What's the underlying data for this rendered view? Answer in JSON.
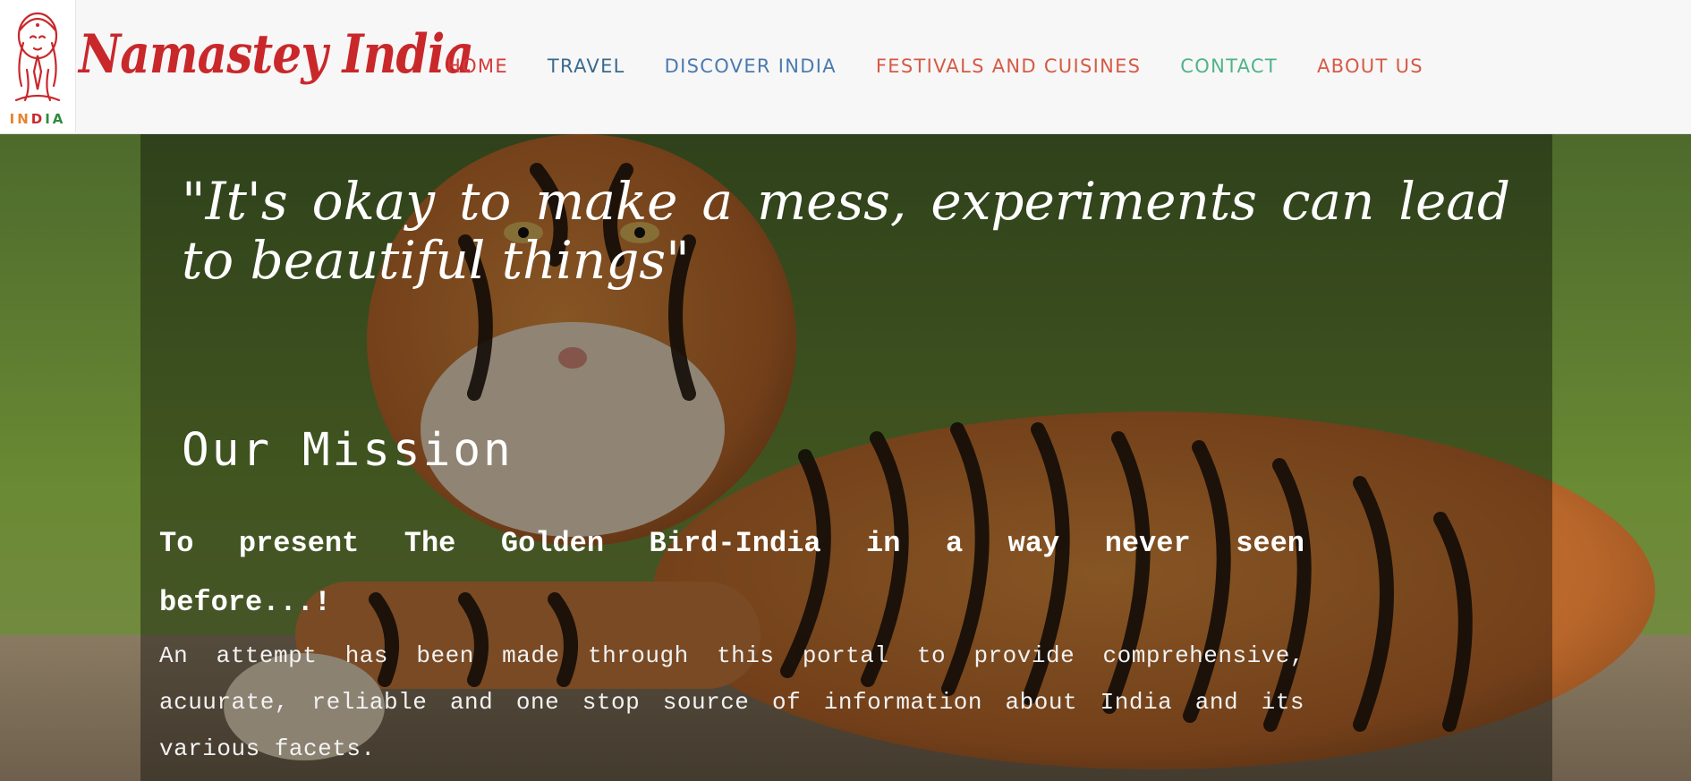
{
  "header": {
    "logo_word": "INDIA",
    "brand": "Namastey India",
    "nav": [
      {
        "label": "HOME",
        "color": "#d63a3a"
      },
      {
        "label": "TRAVEL",
        "color": "#3a6a8f"
      },
      {
        "label": "DISCOVER INDIA",
        "color": "#4a7ab0"
      },
      {
        "label": "FESTIVALS AND CUISINES",
        "color": "#d65a46"
      },
      {
        "label": "CONTACT",
        "color": "#4fb38a"
      },
      {
        "label": "ABOUT US",
        "color": "#d65a46"
      }
    ]
  },
  "hero": {
    "quote": "\"It's okay to make a mess, experiments can lead to beautiful things\"",
    "mission_title": "Our Mission",
    "mission_lead": "To present The Golden Bird-India in a way never seen before...!",
    "mission_body": "An attempt has been made through this portal to provide comprehensive, acuurate, reliable and one stop source of information about India and its various facets."
  },
  "colors": {
    "brand_red": "#c9282b",
    "saffron": "#e8832a",
    "green": "#2e8b3d"
  }
}
